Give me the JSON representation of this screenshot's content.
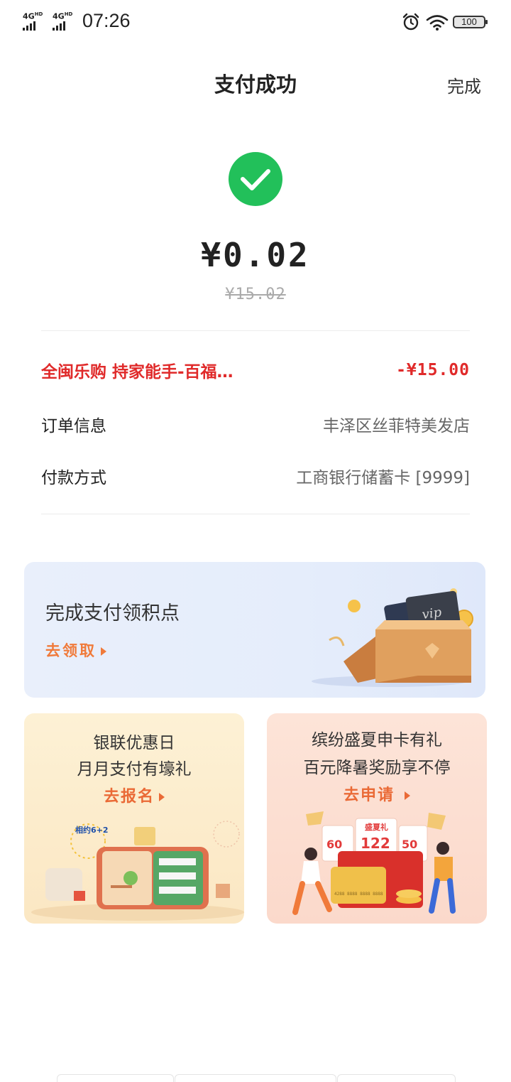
{
  "status_bar": {
    "signal1": "4G",
    "signal1_sup": "HD",
    "signal2": "4G",
    "signal2_sup": "HD",
    "time": "07:26",
    "battery": "100",
    "icons": [
      "alarm-icon",
      "wifi-icon",
      "battery-icon"
    ]
  },
  "header": {
    "title": "支付成功",
    "done_label": "完成"
  },
  "payment": {
    "amount": "¥0.02",
    "original_amount": "¥15.02",
    "status_icon": "check-circle-icon",
    "status_color": "#22c05a"
  },
  "details": {
    "promo_label": "全闽乐购 持家能手-百福…",
    "promo_value": "-¥15.00",
    "order_label": "订单信息",
    "order_value": "丰泽区丝菲特美发店",
    "method_label": "付款方式",
    "method_value": "工商银行储蓄卡 [9999]"
  },
  "points_card": {
    "title": "完成支付领积点",
    "link": "去领取",
    "badge_text": "vip"
  },
  "promo_cards": [
    {
      "line1": "银联优惠日",
      "line2": "月月支付有壕礼",
      "link": "去报名",
      "illustration_text": "相约6+2"
    },
    {
      "line1": "缤纷盛夏申卡有礼",
      "line2": "百元降暑奖励享不停",
      "link": "去申请",
      "illustration_labels": [
        "盛夏礼",
        "60",
        "122",
        "50"
      ],
      "card_number": "4288 8888 8888 8888"
    }
  ],
  "colors": {
    "accent_red": "#e02a2a",
    "link_orange": "#ea6a36",
    "success_green": "#22c05a"
  }
}
